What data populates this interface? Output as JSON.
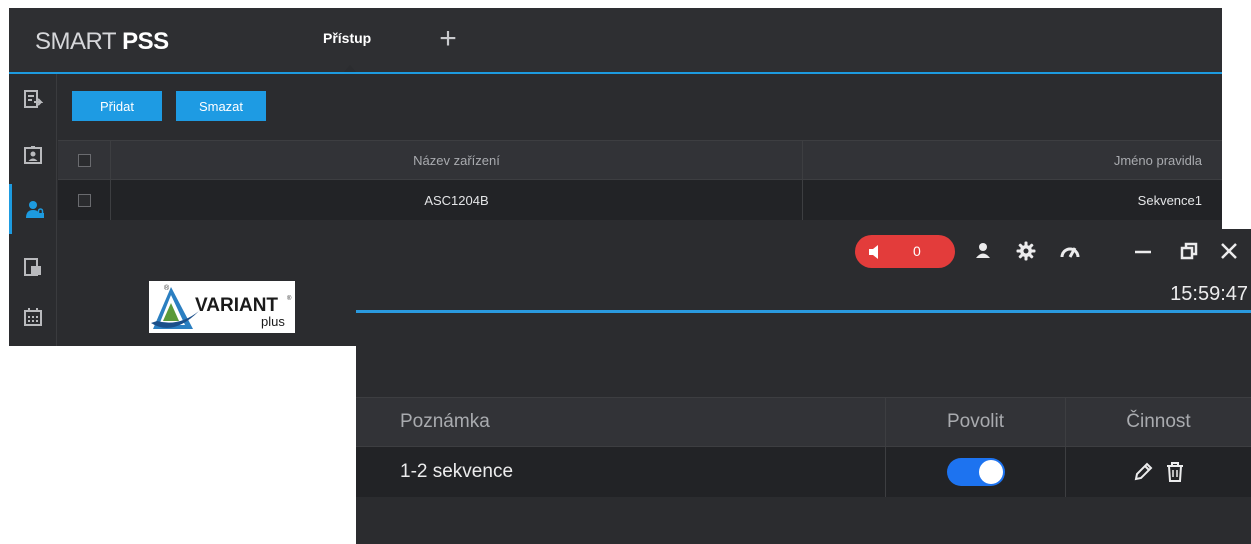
{
  "app": {
    "brand_part1": "SMART",
    "brand_part2": "PSS",
    "active_tab": "Přístup",
    "add_tab_glyph": "+"
  },
  "sidebar": {
    "items": [
      {
        "icon": "device-report-icon",
        "active": false
      },
      {
        "icon": "id-card-icon",
        "active": false
      },
      {
        "icon": "user-lock-icon",
        "active": true
      },
      {
        "icon": "document-icon",
        "active": false
      },
      {
        "icon": "calendar-icon",
        "active": false
      }
    ]
  },
  "toolbar": {
    "add_label": "Přidat",
    "delete_label": "Smazat"
  },
  "device_table": {
    "columns": [
      "Název zařízení",
      "Jméno pravidla"
    ],
    "rows": [
      {
        "device": "ASC1204B",
        "rule": "Sekvence1"
      }
    ]
  },
  "logo": {
    "text_main": "VARIANT",
    "text_sub": "plus",
    "mark": "®"
  },
  "header": {
    "alarm_count": "0",
    "clock": "15:59:47",
    "window_buttons": [
      "minimize-icon",
      "restore-icon",
      "close-icon"
    ]
  },
  "rule_table": {
    "columns": [
      "Poznámka",
      "Povolit",
      "Činnost"
    ],
    "rows": [
      {
        "note": "1-2 sekvence",
        "enabled": true
      }
    ]
  },
  "colors": {
    "accent": "#1d9be0",
    "button": "#1e9be3",
    "alarm": "#e33c3b",
    "toggle_on": "#1d73f0",
    "background": "#2b2c2f"
  }
}
